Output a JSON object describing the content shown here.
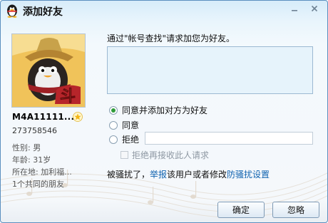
{
  "window": {
    "title": "添加好友",
    "icons": {
      "app": "qq-penguin-icon",
      "minimize": "minimize-icon",
      "close": "close-icon"
    }
  },
  "profile": {
    "nickname": "M4A11111...",
    "qq_number": "273758546",
    "gender": "性别: 男",
    "age": "年龄: 31岁",
    "location": "所在地: 加利福...",
    "common_friends": "1个共同的朋友",
    "avatar_text": "斗"
  },
  "request": {
    "prompt": "通过\"帐号查找\"请求加您为好友。",
    "message": ""
  },
  "options": {
    "agree_add": "同意并添加对方为好友",
    "agree": "同意",
    "reject": "拒绝",
    "reject_reason": "",
    "block_label": "拒绝再接收此人请求"
  },
  "harass": {
    "prefix": "被骚扰了，",
    "report": "举报",
    "middle": "该用户或者修改",
    "settings": "防骚扰设置"
  },
  "buttons": {
    "ok": "确定",
    "ignore": "忽略"
  },
  "colors": {
    "link": "#1063b0",
    "selected_radio": "#2f9b39",
    "border": "#5b8fbf"
  }
}
